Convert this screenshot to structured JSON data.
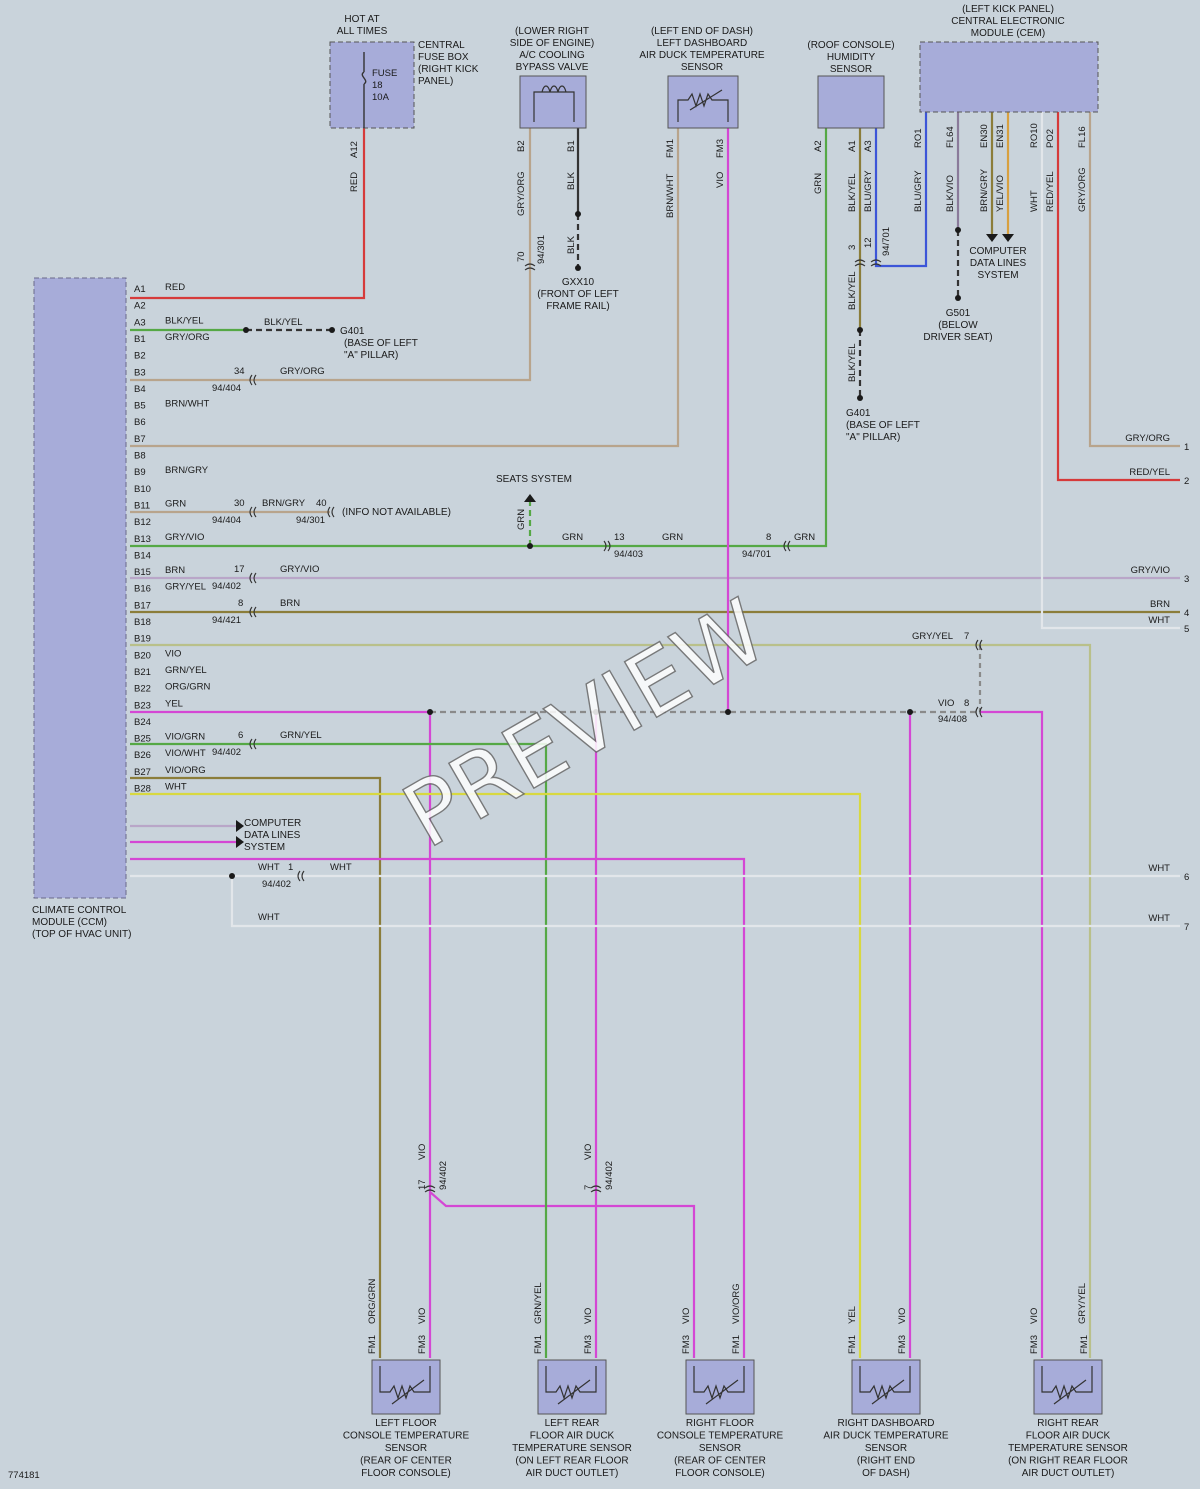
{
  "diagram_id": "774181",
  "watermark": "PREVIEW",
  "colors": {
    "background": "#c9d3db",
    "component_fill": "#a7acd9",
    "red": "#d63a3a",
    "tan": "#b8a48c",
    "green": "#55a845",
    "violet": "#d447d4",
    "blue": "#3c55d8",
    "yellow": "#d8d840",
    "olive": "#8b7d3a",
    "light_olive": "#b9c08a",
    "lavender": "#b9a6c8",
    "white_wire": "#e2e6ea",
    "dark": "#3a3a3a"
  },
  "components": {
    "ccm": {
      "title": [
        "CLIMATE CONTROL",
        "MODULE (CCM)",
        "(TOP OF HVAC UNIT)"
      ]
    },
    "fuse_box": {
      "hot": [
        "HOT AT",
        "ALL TIMES"
      ],
      "title": [
        "CENTRAL",
        "FUSE BOX",
        "(RIGHT KICK",
        "PANEL)"
      ],
      "fuse": [
        "FUSE",
        "18",
        "10A"
      ],
      "pin": "A12"
    },
    "bypass_valve": {
      "title": [
        "(LOWER RIGHT",
        "SIDE OF ENGINE)",
        "A/C COOLING",
        "BYPASS VALVE"
      ],
      "pins": [
        "B2",
        "B1"
      ]
    },
    "left_dash_sensor": {
      "title": [
        "(LEFT END OF DASH)",
        "LEFT DASHBOARD",
        "AIR DUCK TEMPERATURE",
        "SENSOR"
      ],
      "pins": [
        "FM1",
        "FM3"
      ]
    },
    "humidity_sensor": {
      "title": [
        "(ROOF CONSOLE)",
        "HUMIDITY",
        "SENSOR"
      ],
      "pins": [
        "A2",
        "A1",
        "A3"
      ]
    },
    "cem": {
      "title": [
        "(LEFT KICK PANEL)",
        "CENTRAL ELECTRONIC",
        "MODULE (CEM)"
      ],
      "pins": [
        "RO1",
        "FL64",
        "EN30",
        "EN31",
        "RO10",
        "PO2",
        "FL16"
      ],
      "wires": [
        "BLU/GRY",
        "BLK/VIO",
        "BRN/GRY",
        "YEL/VIO",
        "WHT",
        "RED/YEL",
        "GRY/ORG"
      ]
    },
    "computer_data_lines_top": [
      "COMPUTER",
      "DATA LINES",
      "SYSTEM"
    ],
    "computer_data_lines_left": [
      "COMPUTER",
      "DATA LINES",
      "SYSTEM"
    ],
    "seats_system": "SEATS SYSTEM",
    "info_not_available": "(INFO NOT AVAILABLE)"
  },
  "grounds": {
    "g401_top": [
      "G401",
      "(BASE OF LEFT",
      "\"A\" PILLAR)"
    ],
    "g401_mid": [
      "G401",
      "(BASE OF LEFT",
      "\"A\" PILLAR)"
    ],
    "gxx10": [
      "GXX10",
      "(FRONT OF LEFT",
      "FRAME RAIL)"
    ],
    "g501": [
      "G501",
      "(BELOW",
      "DRIVER SEAT)"
    ]
  },
  "ccm_pins": [
    {
      "pin": "A1",
      "wire": "RED"
    },
    {
      "pin": "A2",
      "wire": ""
    },
    {
      "pin": "A3",
      "wire": "BLK/YEL"
    },
    {
      "pin": "B1",
      "wire": "GRY/ORG"
    },
    {
      "pin": "B2",
      "wire": ""
    },
    {
      "pin": "B3",
      "wire": ""
    },
    {
      "pin": "B4",
      "wire": ""
    },
    {
      "pin": "B5",
      "wire": "BRN/WHT"
    },
    {
      "pin": "B6",
      "wire": ""
    },
    {
      "pin": "B7",
      "wire": ""
    },
    {
      "pin": "B8",
      "wire": ""
    },
    {
      "pin": "B9",
      "wire": "BRN/GRY"
    },
    {
      "pin": "B10",
      "wire": ""
    },
    {
      "pin": "B11",
      "wire": "GRN"
    },
    {
      "pin": "B12",
      "wire": ""
    },
    {
      "pin": "B13",
      "wire": "GRY/VIO"
    },
    {
      "pin": "B14",
      "wire": ""
    },
    {
      "pin": "B15",
      "wire": "BRN"
    },
    {
      "pin": "B16",
      "wire": "GRY/YEL"
    },
    {
      "pin": "B17",
      "wire": ""
    },
    {
      "pin": "B18",
      "wire": ""
    },
    {
      "pin": "B19",
      "wire": ""
    },
    {
      "pin": "B20",
      "wire": "VIO"
    },
    {
      "pin": "B21",
      "wire": "GRN/YEL"
    },
    {
      "pin": "B22",
      "wire": "ORG/GRN"
    },
    {
      "pin": "B23",
      "wire": "YEL"
    },
    {
      "pin": "B24",
      "wire": ""
    },
    {
      "pin": "B25",
      "wire": "VIO/GRN"
    },
    {
      "pin": "B26",
      "wire": "VIO/WHT"
    },
    {
      "pin": "B27",
      "wire": "VIO/ORG"
    },
    {
      "pin": "B28",
      "wire": "WHT"
    }
  ],
  "connectors": {
    "c34": {
      "num": "34",
      "id": "94/404"
    },
    "c30": {
      "num": "30",
      "id": "94/404"
    },
    "c40": {
      "num": "40",
      "id": "94/301"
    },
    "c13": {
      "num": "13",
      "id": "94/403"
    },
    "c8a": {
      "num": "8",
      "id": "94/701"
    },
    "c17": {
      "num": "17",
      "id": "94/402"
    },
    "c8b": {
      "num": "8",
      "id": "94/421"
    },
    "c6": {
      "num": "6",
      "id": "94/402"
    },
    "c1": {
      "num": "1",
      "id": "94/402"
    },
    "c7": {
      "num": "7"
    },
    "c8c": {
      "num": "8",
      "id": "94/408"
    },
    "c70": {
      "num": "70",
      "id": "94/301"
    },
    "c3": {
      "num": "3"
    },
    "c12": {
      "num": "12",
      "id": "94/701"
    },
    "c17b": {
      "num": "17",
      "id": "94/402"
    },
    "c7b": {
      "num": "7",
      "id": "94/402"
    }
  },
  "wire_labels": {
    "blk_yel_to_ground": "BLK/YEL",
    "gry_org_b": "GRY/ORG",
    "brn_gry_b": "BRN/GRY",
    "grn": "GRN",
    "gry_vio": "GRY/VIO",
    "brn": "BRN",
    "grn_yel": "GRN/YEL",
    "wht": "WHT",
    "red": "RED",
    "gry_org_v": "GRY/ORG",
    "blk": "BLK",
    "brn_wht": "BRN/WHT",
    "vio": "VIO",
    "grn_v": "GRN",
    "blk_yel": "BLK/YEL",
    "blu_gry": "BLU/GRY",
    "blk_vio": "BLK/VIO",
    "gry_yel": "GRY/YEL",
    "red_yel": "RED/YEL",
    "org_grn": "ORG/GRN",
    "grn_yel_v": "GRN/YEL",
    "vio_org": "VIO/ORG",
    "yel": "YEL",
    "gry_yel_v": "GRY/YEL"
  },
  "right_edge": [
    {
      "num": "1",
      "wire": "GRY/ORG"
    },
    {
      "num": "2",
      "wire": "RED/YEL"
    },
    {
      "num": "3",
      "wire": "GRY/VIO"
    },
    {
      "num": "4",
      "wire": "BRN"
    },
    {
      "num": "5",
      "wire": "WHT"
    },
    {
      "num": "6",
      "wire": "WHT"
    },
    {
      "num": "7",
      "wire": "WHT"
    }
  ],
  "bottom_sensors": [
    {
      "title": [
        "LEFT FLOOR",
        "CONSOLE TEMPERATURE",
        "SENSOR",
        "(REAR OF CENTER",
        "FLOOR CONSOLE)"
      ],
      "pins": [
        "FM1",
        "FM3"
      ]
    },
    {
      "title": [
        "LEFT REAR",
        "FLOOR AIR DUCK",
        "TEMPERATURE SENSOR",
        "(ON LEFT REAR FLOOR",
        "AIR DUCT OUTLET)"
      ],
      "pins": [
        "FM1",
        "FM3"
      ]
    },
    {
      "title": [
        "RIGHT FLOOR",
        "CONSOLE TEMPERATURE",
        "SENSOR",
        "(REAR OF CENTER",
        "FLOOR CONSOLE)"
      ],
      "pins": [
        "FM3",
        "FM1"
      ]
    },
    {
      "title": [
        "RIGHT DASHBOARD",
        "AIR DUCK TEMPERATURE",
        "SENSOR",
        "(RIGHT END",
        "OF DASH)"
      ],
      "pins": [
        "FM1",
        "FM3"
      ]
    },
    {
      "title": [
        "RIGHT REAR",
        "FLOOR AIR DUCK",
        "TEMPERATURE SENSOR",
        "(ON RIGHT REAR FLOOR",
        "AIR DUCT OUTLET)"
      ],
      "pins": [
        "FM3",
        "FM1"
      ]
    }
  ]
}
